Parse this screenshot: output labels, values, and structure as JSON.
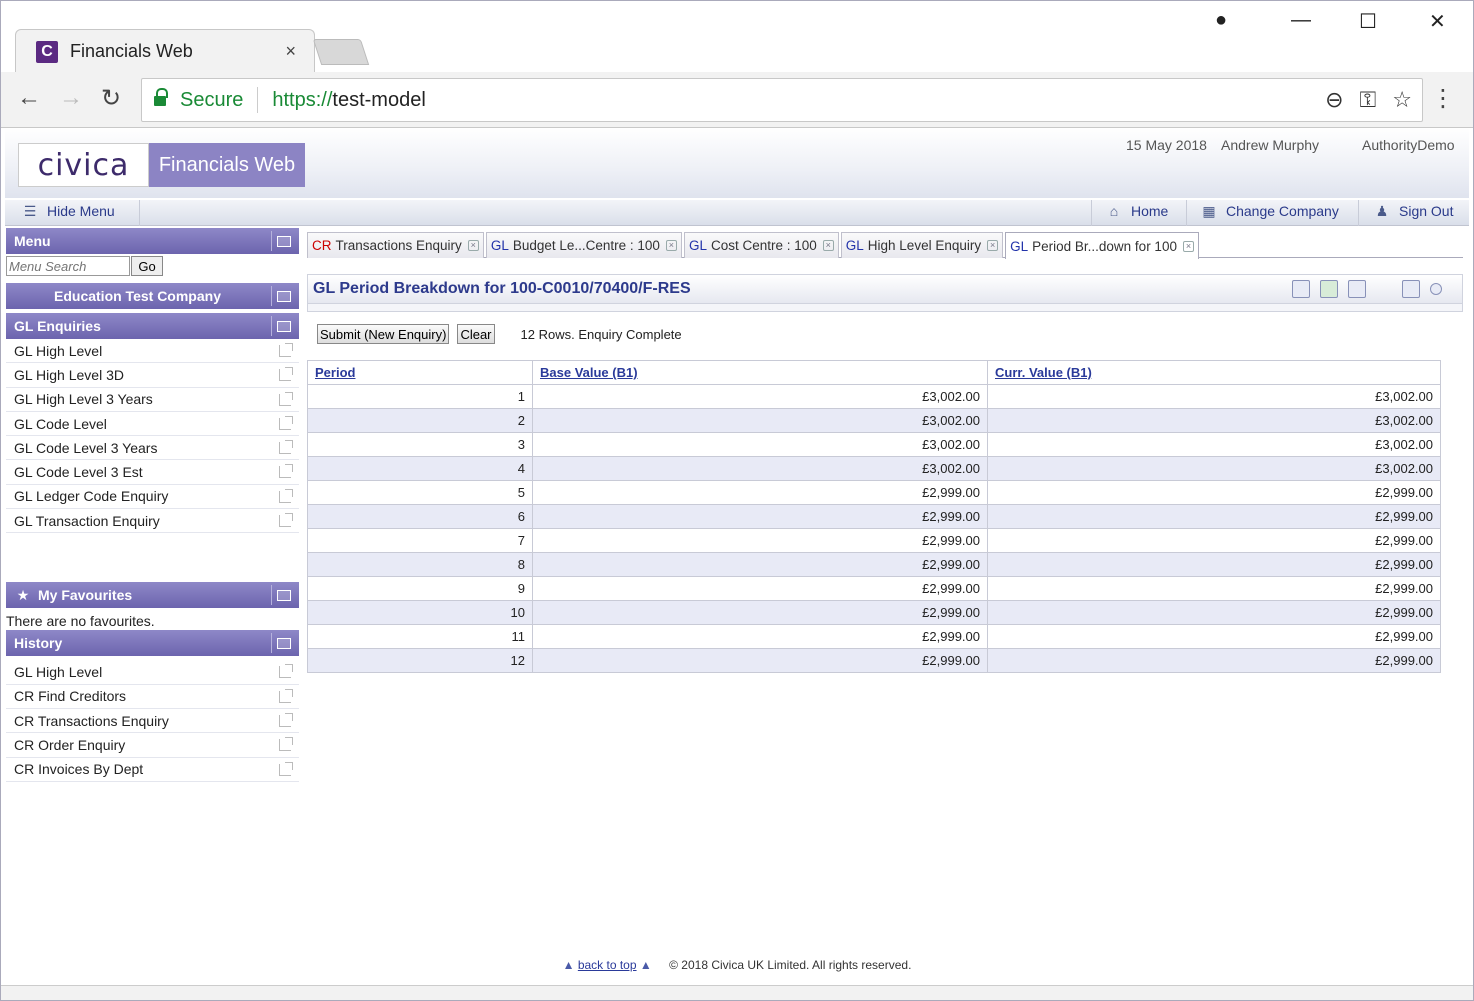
{
  "browser": {
    "tab_title": "Financials Web",
    "favicon_letter": "C",
    "tab_close": "×",
    "secure_label": "Secure",
    "url_scheme": "https://",
    "url_host": "test-model"
  },
  "app": {
    "logo_text": "civica",
    "product_name": "Financials Web",
    "date": "15 May 2018",
    "user": "Andrew Murphy",
    "authority": "AuthorityDemo"
  },
  "toolbar": {
    "hide_menu": "Hide Menu",
    "home": "Home",
    "change_company": "Change Company",
    "sign_out": "Sign Out"
  },
  "sidebar": {
    "menu_title": "Menu",
    "search_placeholder": "Menu Search",
    "go_label": "Go",
    "company": "Education Test Company",
    "section_title": "GL Enquiries",
    "items": [
      "GL High Level",
      "GL High Level 3D",
      "GL High Level 3 Years",
      "GL Code Level",
      "GL Code Level 3 Years",
      "GL Code Level 3 Est",
      "GL Ledger Code Enquiry",
      "GL Transaction Enquiry"
    ],
    "favourites_title": "My Favourites",
    "favourites_empty": "There are no favourites.",
    "history_title": "History",
    "history": [
      "GL High Level",
      "CR Find Creditors",
      "CR Transactions Enquiry",
      "CR Order Enquiry",
      "CR Invoices By Dept"
    ]
  },
  "content": {
    "tabs": [
      {
        "mod": "CR",
        "label": "Transactions Enquiry",
        "mod_color": "#cc0000"
      },
      {
        "mod": "GL",
        "label": "Budget Le...Centre : 100",
        "mod_color": "#2233aa"
      },
      {
        "mod": "GL",
        "label": "Cost Centre : 100",
        "mod_color": "#2233aa"
      },
      {
        "mod": "GL",
        "label": "High Level Enquiry",
        "mod_color": "#2233aa"
      },
      {
        "mod": "GL",
        "label": "Period Br...down for 100",
        "mod_color": "#2233aa"
      }
    ],
    "panel_title": "GL Period Breakdown for 100-C0010/70400/F-RES",
    "submit_label": "Submit (New Enquiry)",
    "clear_label": "Clear",
    "status": "12 Rows. Enquiry Complete",
    "columns": [
      "Period",
      "Base Value (B1)",
      "Curr. Value (B1)"
    ],
    "rows": [
      [
        "1",
        "£3,002.00",
        "£3,002.00"
      ],
      [
        "2",
        "£3,002.00",
        "£3,002.00"
      ],
      [
        "3",
        "£3,002.00",
        "£3,002.00"
      ],
      [
        "4",
        "£3,002.00",
        "£3,002.00"
      ],
      [
        "5",
        "£2,999.00",
        "£2,999.00"
      ],
      [
        "6",
        "£2,999.00",
        "£2,999.00"
      ],
      [
        "7",
        "£2,999.00",
        "£2,999.00"
      ],
      [
        "8",
        "£2,999.00",
        "£2,999.00"
      ],
      [
        "9",
        "£2,999.00",
        "£2,999.00"
      ],
      [
        "10",
        "£2,999.00",
        "£2,999.00"
      ],
      [
        "11",
        "£2,999.00",
        "£2,999.00"
      ],
      [
        "12",
        "£2,999.00",
        "£2,999.00"
      ]
    ]
  },
  "footer": {
    "back_to_top": "back to top",
    "copyright": "© 2018 Civica UK Limited. All rights reserved."
  }
}
